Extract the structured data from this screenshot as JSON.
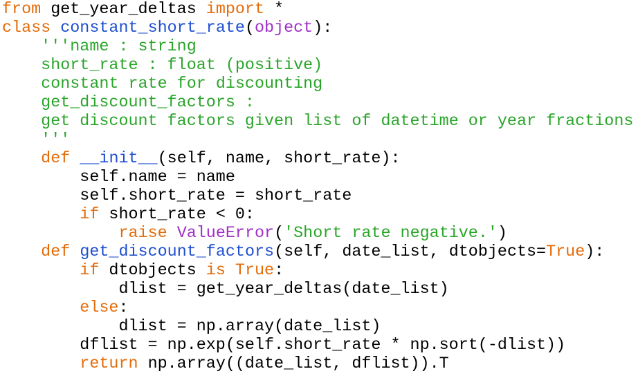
{
  "editor": {
    "colors": {
      "keyword": "#e46c0a",
      "function_name": "#1f4fd1",
      "docstring": "#2aa52a",
      "builtin": "#a030c8",
      "text": "#000000",
      "background": "#ffffff"
    },
    "lines": [
      [
        {
          "t": "from",
          "c": "kw"
        },
        {
          "t": " get_year_deltas ",
          "c": "pl"
        },
        {
          "t": "import",
          "c": "kw"
        },
        {
          "t": " *",
          "c": "pl"
        }
      ],
      [
        {
          "t": "class",
          "c": "kw"
        },
        {
          "t": " ",
          "c": "pl"
        },
        {
          "t": "constant_short_rate",
          "c": "fn"
        },
        {
          "t": "(",
          "c": "pl"
        },
        {
          "t": "object",
          "c": "bi"
        },
        {
          "t": "):",
          "c": "pl"
        }
      ],
      [
        {
          "t": "    ",
          "c": "pl"
        },
        {
          "t": "'''name : string",
          "c": "doc"
        }
      ],
      [
        {
          "t": "    ",
          "c": "pl"
        },
        {
          "t": "short_rate : float (positive)",
          "c": "doc"
        }
      ],
      [
        {
          "t": "    ",
          "c": "pl"
        },
        {
          "t": "constant rate for discounting",
          "c": "doc"
        }
      ],
      [
        {
          "t": "    ",
          "c": "pl"
        },
        {
          "t": "get_discount_factors :",
          "c": "doc"
        }
      ],
      [
        {
          "t": "    ",
          "c": "pl"
        },
        {
          "t": "get discount factors given list of datetime or year fractions",
          "c": "doc"
        }
      ],
      [
        {
          "t": "    ",
          "c": "pl"
        },
        {
          "t": "'''",
          "c": "doc"
        }
      ],
      [
        {
          "t": "    ",
          "c": "pl"
        },
        {
          "t": "def",
          "c": "kw"
        },
        {
          "t": " ",
          "c": "pl"
        },
        {
          "t": "__init__",
          "c": "fn"
        },
        {
          "t": "(self, name, short_rate):",
          "c": "pl"
        }
      ],
      [
        {
          "t": "        self.name = name",
          "c": "pl"
        }
      ],
      [
        {
          "t": "        self.short_rate = short_rate",
          "c": "pl"
        }
      ],
      [
        {
          "t": "        ",
          "c": "pl"
        },
        {
          "t": "if",
          "c": "kw"
        },
        {
          "t": " short_rate < 0:",
          "c": "pl"
        }
      ],
      [
        {
          "t": "            ",
          "c": "pl"
        },
        {
          "t": "raise",
          "c": "kw"
        },
        {
          "t": " ",
          "c": "pl"
        },
        {
          "t": "ValueError",
          "c": "bi"
        },
        {
          "t": "(",
          "c": "pl"
        },
        {
          "t": "'Short rate negative.'",
          "c": "str"
        },
        {
          "t": ")",
          "c": "pl"
        }
      ],
      [
        {
          "t": "    ",
          "c": "pl"
        },
        {
          "t": "def",
          "c": "kw"
        },
        {
          "t": " ",
          "c": "pl"
        },
        {
          "t": "get_discount_factors",
          "c": "fn"
        },
        {
          "t": "(self, date_list, dtobjects=",
          "c": "pl"
        },
        {
          "t": "True",
          "c": "kw"
        },
        {
          "t": "):",
          "c": "pl"
        }
      ],
      [
        {
          "t": "        ",
          "c": "pl"
        },
        {
          "t": "if",
          "c": "kw"
        },
        {
          "t": " dtobjects ",
          "c": "pl"
        },
        {
          "t": "is",
          "c": "kw"
        },
        {
          "t": " ",
          "c": "pl"
        },
        {
          "t": "True",
          "c": "kw"
        },
        {
          "t": ":",
          "c": "pl"
        }
      ],
      [
        {
          "t": "            dlist = get_year_deltas(date_list)",
          "c": "pl"
        }
      ],
      [
        {
          "t": "        ",
          "c": "pl"
        },
        {
          "t": "else",
          "c": "kw"
        },
        {
          "t": ":",
          "c": "pl"
        }
      ],
      [
        {
          "t": "            dlist = np.array(date_list)",
          "c": "pl"
        }
      ],
      [
        {
          "t": "        dflist = np.exp(self.short_rate * np.sort(-dlist))",
          "c": "pl"
        }
      ],
      [
        {
          "t": "        ",
          "c": "pl"
        },
        {
          "t": "return",
          "c": "kw"
        },
        {
          "t": " np.array((date_list, dflist)).T",
          "c": "pl"
        }
      ]
    ]
  }
}
